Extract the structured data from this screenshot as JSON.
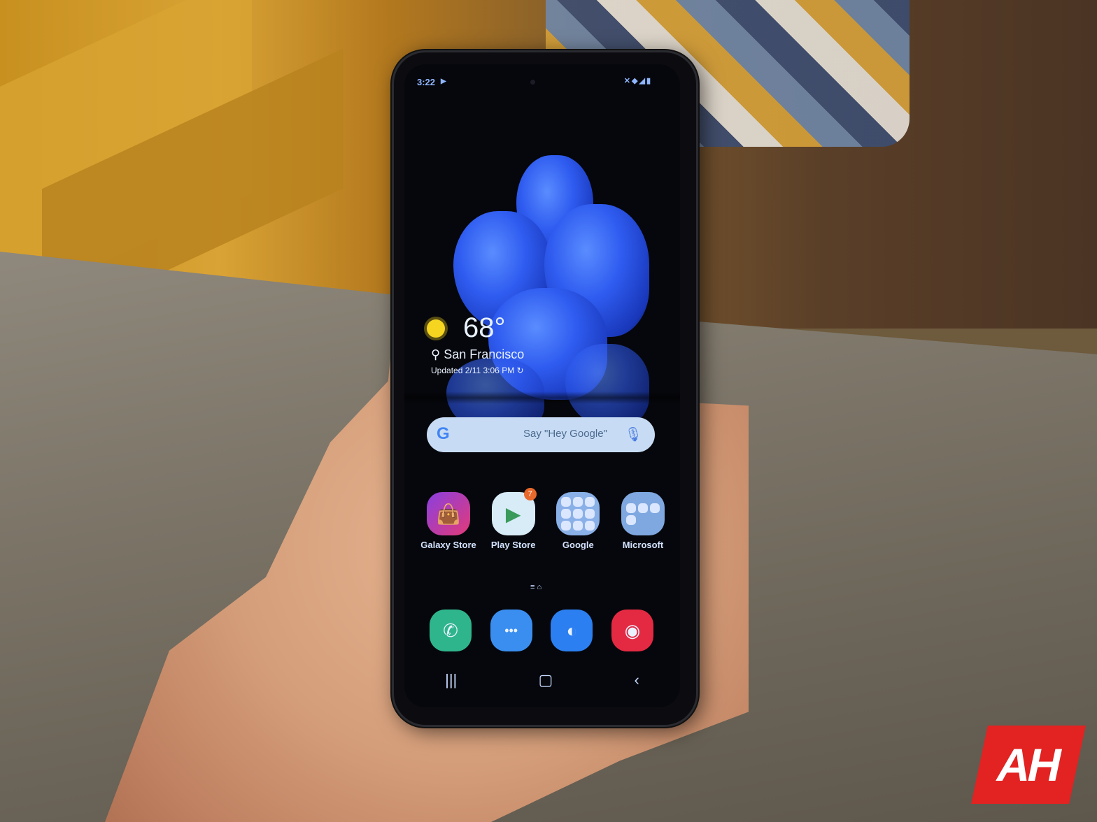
{
  "scene": {
    "description": "Hand holding unfolded Samsung flip phone showing home screen",
    "watermark": "AH"
  },
  "status_bar": {
    "time": "3:22",
    "cast_icon": "play-arrow-icon",
    "system_icons": [
      "mute-icon",
      "wifi-icon",
      "signal-icon",
      "battery-icon"
    ]
  },
  "weather": {
    "icon": "sun-icon",
    "temperature": "68°",
    "location_icon": "location-pin-icon",
    "city": "San Francisco",
    "updated": "Updated 2/11 3:06 PM",
    "refresh_icon": "refresh-icon"
  },
  "search": {
    "logo": "G",
    "placeholder": "Say \"Hey Google\"",
    "mic_icon": "mic-icon"
  },
  "apps": [
    {
      "label": "Galaxy Store",
      "icon": "shopping-bag-icon",
      "color": "#c6419a"
    },
    {
      "label": "Play Store",
      "icon": "play-store-icon",
      "color": "#d8ecf8",
      "badge": "7"
    },
    {
      "label": "Google",
      "icon": "folder-icon",
      "color": "#8ab0e8"
    },
    {
      "label": "Microsoft",
      "icon": "folder-icon",
      "color": "#7fa8e0"
    }
  ],
  "page_indicator": "≡ ⌂",
  "dock": [
    {
      "name": "phone",
      "icon": "phone-icon",
      "color": "#2fb58c",
      "glyph": "✆"
    },
    {
      "name": "messages",
      "icon": "chat-icon",
      "color": "#3a8ef0",
      "glyph": "•••"
    },
    {
      "name": "internet",
      "icon": "planet-icon",
      "color": "#2b7ff0",
      "glyph": "◐"
    },
    {
      "name": "camera",
      "icon": "camera-icon",
      "color": "#e32a42",
      "glyph": "◉"
    }
  ],
  "nav": {
    "recents": "|||",
    "home": "▢",
    "back": "‹"
  },
  "colors": {
    "status_text": "#8fb6ff",
    "search_bg": "#c7dcf4",
    "watermark_red": "#e32222"
  }
}
